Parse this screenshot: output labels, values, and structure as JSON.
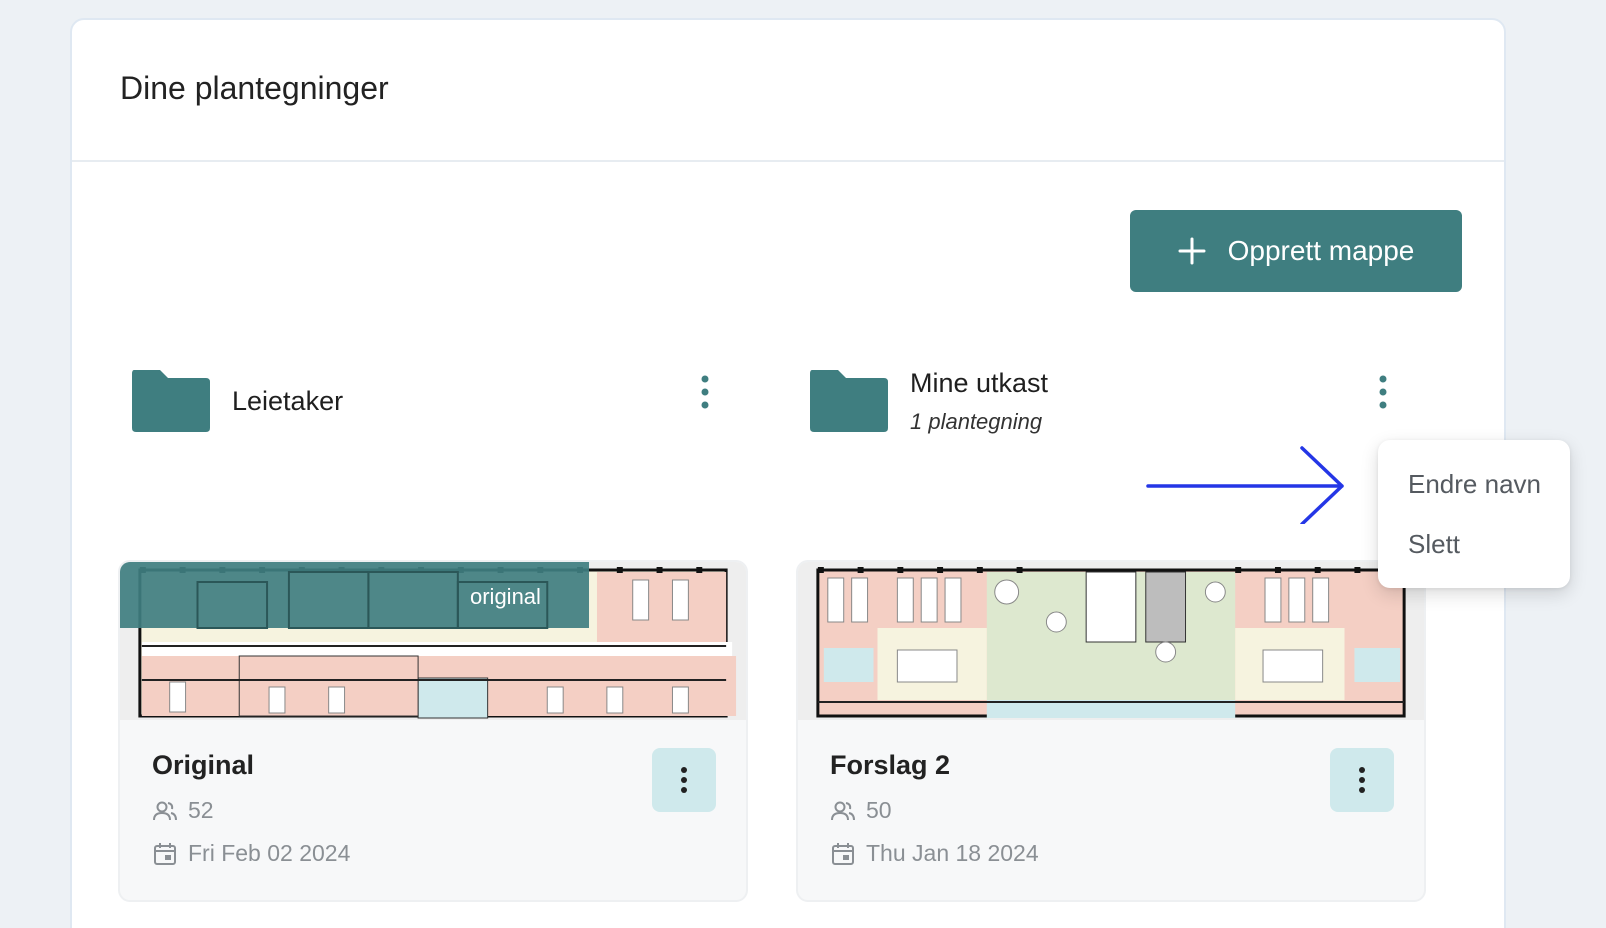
{
  "colors": {
    "accent": "#3f7e80",
    "kebab": "#3f7e80",
    "card_button_bg": "#cfe9ec",
    "arrow": "#2436e6"
  },
  "panel": {
    "title": "Dine plantegninger"
  },
  "toolbar": {
    "create_folder_label": "Opprett mappe",
    "create_folder_icon": "plus-icon"
  },
  "folders": [
    {
      "name": "Leietaker",
      "subtitle": "",
      "icon": "folder-icon"
    },
    {
      "name": "Mine utkast",
      "subtitle": "1 plantegning",
      "icon": "folder-icon"
    }
  ],
  "context_menu": {
    "items": [
      {
        "label": "Endre navn"
      },
      {
        "label": "Slett"
      }
    ]
  },
  "plans": [
    {
      "title": "Original",
      "badge": "original",
      "people": "52",
      "date": "Fri Feb 02 2024",
      "people_icon": "people-icon",
      "date_icon": "calendar-icon"
    },
    {
      "title": "Forslag 2",
      "badge": "",
      "people": "50",
      "date": "Thu Jan 18 2024",
      "people_icon": "people-icon",
      "date_icon": "calendar-icon"
    }
  ]
}
